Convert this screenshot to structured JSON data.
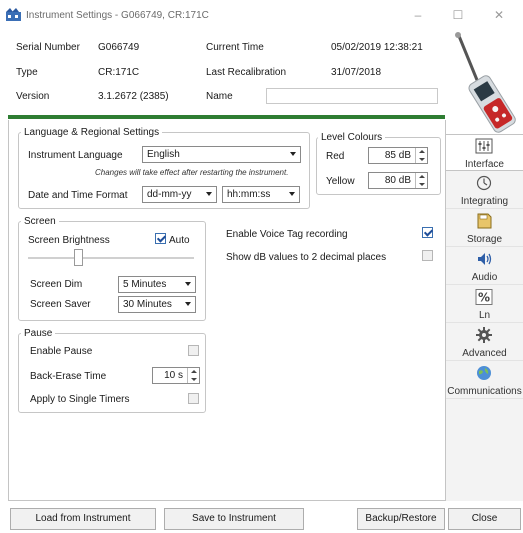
{
  "window": {
    "title": "Instrument Settings - G066749, CR:171C",
    "minimize": "–",
    "maximize": "☐",
    "close": "✕"
  },
  "info": {
    "serial_label": "Serial Number",
    "serial_value": "G066749",
    "type_label": "Type",
    "type_value": "CR:171C",
    "version_label": "Version",
    "version_value": "3.1.2672  (2385)",
    "current_time_label": "Current Time",
    "current_time_value": "05/02/2019 12:38:21",
    "recal_label": "Last Recalibration",
    "recal_value": "31/07/2018",
    "name_label": "Name",
    "name_value": ""
  },
  "language": {
    "legend": "Language & Regional Settings",
    "instrument_language_label": "Instrument Language",
    "instrument_language_value": "English",
    "note": "Changes will take effect after restarting the instrument.",
    "date_time_label": "Date and Time Format",
    "date_format_value": "dd-mm-yy",
    "time_format_value": "hh:mm:ss"
  },
  "level_colours": {
    "legend": "Level Colours",
    "red_label": "Red",
    "red_value": "85 dB",
    "yellow_label": "Yellow",
    "yellow_value": "80 dB"
  },
  "screen": {
    "legend": "Screen",
    "brightness_label": "Screen Brightness",
    "auto_label": "Auto",
    "auto_checked": true,
    "brightness_level": 0.3,
    "dim_label": "Screen Dim",
    "dim_value": "5 Minutes",
    "saver_label": "Screen Saver",
    "saver_value": "30 Minutes"
  },
  "options": {
    "voice_tag_label": "Enable Voice Tag recording",
    "voice_tag_checked": true,
    "two_decimals_label": "Show dB values to 2 decimal places",
    "two_decimals_checked": false
  },
  "pause": {
    "legend": "Pause",
    "enable_label": "Enable Pause",
    "enable_checked": false,
    "back_erase_label": "Back-Erase Time",
    "back_erase_value": "10 s",
    "single_timers_label": "Apply to Single Timers",
    "single_timers_checked": false
  },
  "tabs": [
    {
      "label": "Interface",
      "icon": "interface-icon",
      "active": true
    },
    {
      "label": "Integrating",
      "icon": "stopwatch-icon",
      "active": false
    },
    {
      "label": "Storage",
      "icon": "storage-card-icon",
      "active": false
    },
    {
      "label": "Audio",
      "icon": "speaker-icon",
      "active": false
    },
    {
      "label": "Ln",
      "icon": "percent-icon",
      "active": false
    },
    {
      "label": "Advanced",
      "icon": "gear-icon",
      "active": false
    },
    {
      "label": "Communications",
      "icon": "globe-icon",
      "active": false
    }
  ],
  "buttons": {
    "load": "Load from Instrument",
    "save": "Save to Instrument",
    "backup": "Backup/Restore",
    "close": "Close"
  },
  "colors": {
    "accent_green": "#2e7d32",
    "check_blue": "#1f4e99"
  }
}
